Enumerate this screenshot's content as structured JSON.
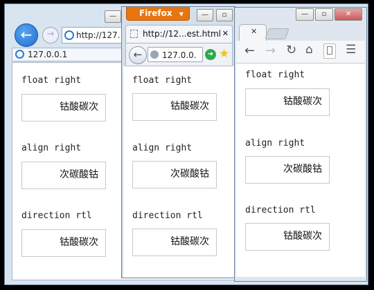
{
  "ie": {
    "address": "http://127.",
    "tab_title": "127.0.0.1",
    "sections": [
      {
        "label": "float right",
        "box_text": "钴酸碳次"
      },
      {
        "label": "align right",
        "box_text": "次碳酸钴"
      },
      {
        "label": "direction rtl",
        "box_text": "钴酸碳次"
      }
    ]
  },
  "firefox": {
    "menu_label": "Firefox",
    "tab_title": "http://12...est.html",
    "address": "127.0.0.",
    "sections": [
      {
        "label": "float right",
        "box_text": "钴酸碳次"
      },
      {
        "label": "align right",
        "box_text": "次碳酸钴"
      },
      {
        "label": "direction rtl",
        "box_text": "钴酸碳次"
      }
    ]
  },
  "chrome": {
    "sections": [
      {
        "label": "float right",
        "box_text": "钴酸碳次"
      },
      {
        "label": "align right",
        "box_text": "次碳酸钴"
      },
      {
        "label": "direction rtl",
        "box_text": "钴酸碳次"
      }
    ]
  },
  "window_controls": {
    "minimize": "—",
    "maximize": "▫",
    "close": "✕"
  },
  "colors": {
    "firefox_orange": "#e8750f",
    "ie_blue": "#1e6fd0",
    "go_green": "#2fa84f"
  }
}
